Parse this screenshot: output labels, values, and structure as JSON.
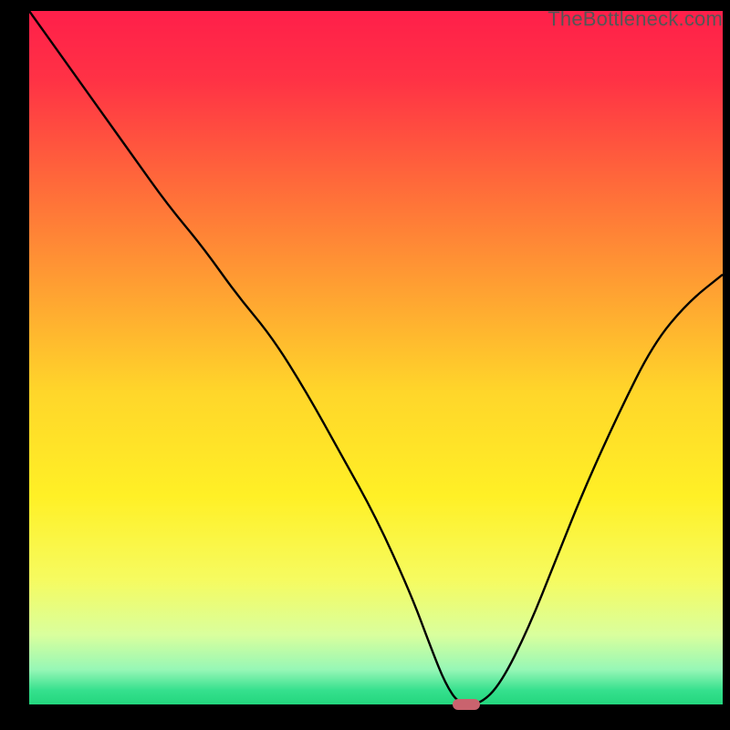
{
  "watermark": "TheBottleneck.com",
  "colors": {
    "frame": "#000000",
    "curve": "#000000",
    "marker": "#c9636e",
    "gradient_stops": [
      {
        "offset": 0.0,
        "color": "#ff1f4a"
      },
      {
        "offset": 0.1,
        "color": "#ff3245"
      },
      {
        "offset": 0.25,
        "color": "#ff6a3a"
      },
      {
        "offset": 0.4,
        "color": "#ffa032"
      },
      {
        "offset": 0.55,
        "color": "#ffd62a"
      },
      {
        "offset": 0.7,
        "color": "#fff026"
      },
      {
        "offset": 0.82,
        "color": "#f6fb60"
      },
      {
        "offset": 0.9,
        "color": "#d9ff9d"
      },
      {
        "offset": 0.95,
        "color": "#96f7b6"
      },
      {
        "offset": 0.98,
        "color": "#35e08d"
      },
      {
        "offset": 1.0,
        "color": "#23d67e"
      }
    ]
  },
  "chart_data": {
    "type": "line",
    "title": "",
    "xlabel": "",
    "ylabel": "",
    "xlim": [
      0,
      100
    ],
    "ylim": [
      0,
      100
    ],
    "grid": false,
    "legend": false,
    "series": [
      {
        "name": "bottleneck-curve",
        "x": [
          0,
          5,
          10,
          15,
          20,
          25,
          30,
          35,
          40,
          45,
          50,
          55,
          58,
          60,
          62,
          65,
          68,
          72,
          76,
          80,
          85,
          90,
          95,
          100
        ],
        "values": [
          100,
          93,
          86,
          79,
          72,
          66,
          59,
          53,
          45,
          36,
          27,
          16,
          8,
          3,
          0,
          0,
          3,
          11,
          21,
          31,
          42,
          52,
          58,
          62
        ]
      }
    ],
    "marker": {
      "x": 63,
      "y": 0,
      "width_pct": 4.0,
      "height_pct": 1.6
    },
    "notes": "Gradient background encodes severity (red=high, green=low). Curve shows bottleneck percentage vs. an implicit x-axis variable; minimum near x≈62."
  }
}
